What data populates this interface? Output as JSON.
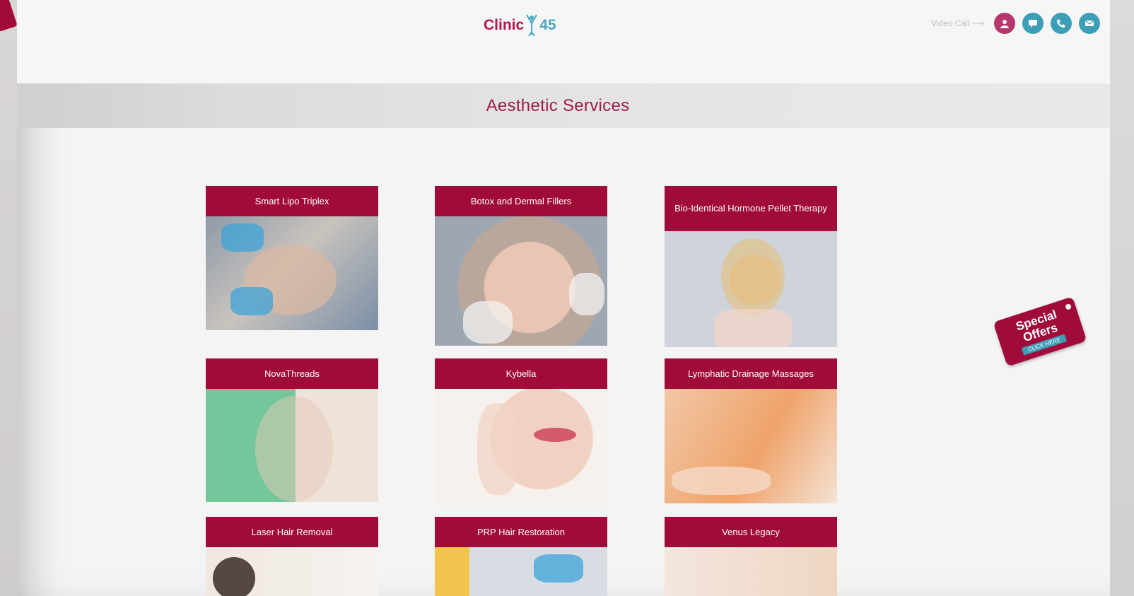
{
  "header": {
    "logo_text_left": "Clinic",
    "logo_text_right": "45",
    "video_call_label": "Video Call ⟶",
    "icons": [
      "user-icon",
      "chat-icon",
      "phone-icon",
      "mail-icon"
    ]
  },
  "page_title": "Aesthetic Services",
  "services": [
    {
      "label": "Smart Lipo Triplex"
    },
    {
      "label": "Botox and Dermal Fillers"
    },
    {
      "label": "Bio-Identical Hormone Pellet Therapy"
    },
    {
      "label": "NovaThreads"
    },
    {
      "label": "Kybella"
    },
    {
      "label": "Lymphatic Drainage Massages"
    },
    {
      "label": "Laser Hair Removal"
    },
    {
      "label": "PRP Hair Restoration"
    },
    {
      "label": "Venus Legacy"
    }
  ],
  "special_offer": {
    "line1": "Special",
    "line2": "Offers",
    "cta": "CLICK HERE"
  },
  "colors": {
    "brand": "#a10b3a",
    "accent": "#3c9fb7"
  }
}
